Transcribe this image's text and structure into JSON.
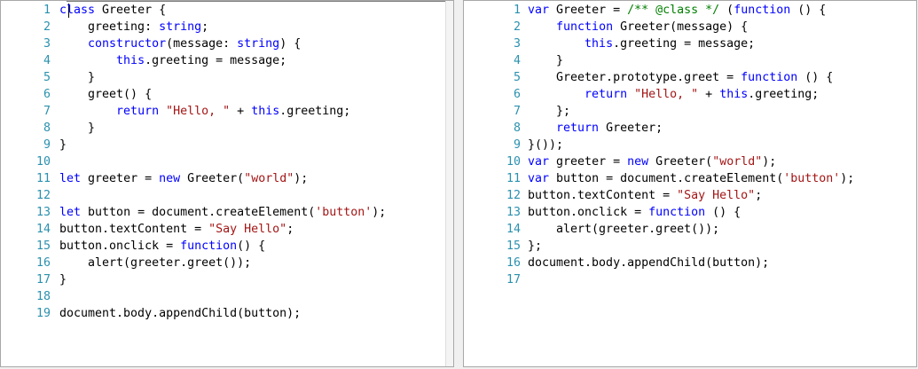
{
  "left_pane": {
    "lines": [
      {
        "n": "1",
        "t": [
          [
            "kw",
            "class"
          ],
          [
            "txt",
            " Greeter {"
          ]
        ]
      },
      {
        "n": "2",
        "t": [
          [
            "txt",
            "    greeting: "
          ],
          [
            "kw",
            "string"
          ],
          [
            "txt",
            ";"
          ]
        ]
      },
      {
        "n": "3",
        "t": [
          [
            "txt",
            "    "
          ],
          [
            "kw",
            "constructor"
          ],
          [
            "txt",
            "(message: "
          ],
          [
            "kw",
            "string"
          ],
          [
            "txt",
            ") {"
          ]
        ]
      },
      {
        "n": "4",
        "t": [
          [
            "txt",
            "        "
          ],
          [
            "kw",
            "this"
          ],
          [
            "txt",
            ".greeting = message;"
          ]
        ]
      },
      {
        "n": "5",
        "t": [
          [
            "txt",
            "    }"
          ]
        ]
      },
      {
        "n": "6",
        "t": [
          [
            "txt",
            "    greet() {"
          ]
        ]
      },
      {
        "n": "7",
        "t": [
          [
            "txt",
            "        "
          ],
          [
            "kw",
            "return"
          ],
          [
            "txt",
            " "
          ],
          [
            "str",
            "\"Hello, \""
          ],
          [
            "txt",
            " + "
          ],
          [
            "kw",
            "this"
          ],
          [
            "txt",
            ".greeting;"
          ]
        ]
      },
      {
        "n": "8",
        "t": [
          [
            "txt",
            "    }"
          ]
        ]
      },
      {
        "n": "9",
        "t": [
          [
            "txt",
            "}"
          ]
        ]
      },
      {
        "n": "10",
        "t": []
      },
      {
        "n": "11",
        "t": [
          [
            "kw",
            "let"
          ],
          [
            "txt",
            " greeter = "
          ],
          [
            "kw",
            "new"
          ],
          [
            "txt",
            " Greeter("
          ],
          [
            "str",
            "\"world\""
          ],
          [
            "txt",
            ");"
          ]
        ]
      },
      {
        "n": "12",
        "t": []
      },
      {
        "n": "13",
        "t": [
          [
            "kw",
            "let"
          ],
          [
            "txt",
            " button = document.createElement("
          ],
          [
            "str",
            "'button'"
          ],
          [
            "txt",
            ");"
          ]
        ]
      },
      {
        "n": "14",
        "t": [
          [
            "txt",
            "button.textContent = "
          ],
          [
            "str",
            "\"Say Hello\""
          ],
          [
            "txt",
            ";"
          ]
        ]
      },
      {
        "n": "15",
        "t": [
          [
            "txt",
            "button.onclick = "
          ],
          [
            "kw",
            "function"
          ],
          [
            "txt",
            "() {"
          ]
        ]
      },
      {
        "n": "16",
        "t": [
          [
            "txt",
            "    alert(greeter.greet());"
          ]
        ]
      },
      {
        "n": "17",
        "t": [
          [
            "txt",
            "}"
          ]
        ]
      },
      {
        "n": "18",
        "t": []
      },
      {
        "n": "19",
        "t": [
          [
            "txt",
            "document.body.appendChild(button);"
          ]
        ]
      }
    ]
  },
  "right_pane": {
    "lines": [
      {
        "n": "1",
        "t": [
          [
            "kw",
            "var"
          ],
          [
            "txt",
            " Greeter = "
          ],
          [
            "cm",
            "/** @class */"
          ],
          [
            "txt",
            " ("
          ],
          [
            "kw",
            "function"
          ],
          [
            "txt",
            " () {"
          ]
        ]
      },
      {
        "n": "2",
        "t": [
          [
            "txt",
            "    "
          ],
          [
            "kw",
            "function"
          ],
          [
            "txt",
            " Greeter(message) {"
          ]
        ]
      },
      {
        "n": "3",
        "t": [
          [
            "txt",
            "        "
          ],
          [
            "kw",
            "this"
          ],
          [
            "txt",
            ".greeting = message;"
          ]
        ]
      },
      {
        "n": "4",
        "t": [
          [
            "txt",
            "    }"
          ]
        ]
      },
      {
        "n": "5",
        "t": [
          [
            "txt",
            "    Greeter.prototype.greet = "
          ],
          [
            "kw",
            "function"
          ],
          [
            "txt",
            " () {"
          ]
        ]
      },
      {
        "n": "6",
        "t": [
          [
            "txt",
            "        "
          ],
          [
            "kw",
            "return"
          ],
          [
            "txt",
            " "
          ],
          [
            "str",
            "\"Hello, \""
          ],
          [
            "txt",
            " + "
          ],
          [
            "kw",
            "this"
          ],
          [
            "txt",
            ".greeting;"
          ]
        ]
      },
      {
        "n": "7",
        "t": [
          [
            "txt",
            "    };"
          ]
        ]
      },
      {
        "n": "8",
        "t": [
          [
            "txt",
            "    "
          ],
          [
            "kw",
            "return"
          ],
          [
            "txt",
            " Greeter;"
          ]
        ]
      },
      {
        "n": "9",
        "t": [
          [
            "txt",
            "}());"
          ]
        ]
      },
      {
        "n": "10",
        "t": [
          [
            "kw",
            "var"
          ],
          [
            "txt",
            " greeter = "
          ],
          [
            "kw",
            "new"
          ],
          [
            "txt",
            " Greeter("
          ],
          [
            "str",
            "\"world\""
          ],
          [
            "txt",
            ");"
          ]
        ]
      },
      {
        "n": "11",
        "t": [
          [
            "kw",
            "var"
          ],
          [
            "txt",
            " button = document.createElement("
          ],
          [
            "str",
            "'button'"
          ],
          [
            "txt",
            ");"
          ]
        ]
      },
      {
        "n": "12",
        "t": [
          [
            "txt",
            "button.textContent = "
          ],
          [
            "str",
            "\"Say Hello\""
          ],
          [
            "txt",
            ";"
          ]
        ]
      },
      {
        "n": "13",
        "t": [
          [
            "txt",
            "button.onclick = "
          ],
          [
            "kw",
            "function"
          ],
          [
            "txt",
            " () {"
          ]
        ]
      },
      {
        "n": "14",
        "t": [
          [
            "txt",
            "    alert(greeter.greet());"
          ]
        ]
      },
      {
        "n": "15",
        "t": [
          [
            "txt",
            "};"
          ]
        ]
      },
      {
        "n": "16",
        "t": [
          [
            "txt",
            "document.body.appendChild(button);"
          ]
        ]
      },
      {
        "n": "17",
        "t": []
      }
    ]
  },
  "colors": {
    "line_number": "#2b91af",
    "keyword": "#0000ff",
    "string": "#a31515",
    "comment": "#008000",
    "text": "#000000"
  }
}
